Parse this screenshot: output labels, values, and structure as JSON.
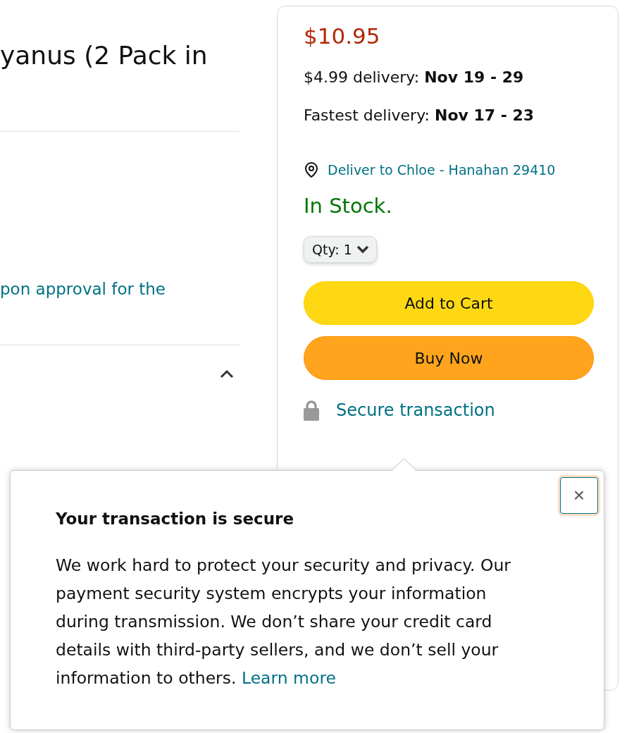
{
  "product": {
    "title": "yanus (2 Pack in",
    "note_link": "pon approval for the",
    "section_expanded": true
  },
  "buy_box": {
    "price": "$10.95",
    "delivery": [
      "$4.99 delivery: **Nov 19 - 29**",
      "Fastest delivery: **Nov 17 - 23**"
    ],
    "deliver_to": "Deliver to Chloe - Hanahan 29410",
    "stock": "In Stock.",
    "quantity": {
      "label": "Qty:",
      "value": "1"
    },
    "buttons": [
      {
        "label": "Add to Cart",
        "kind": "cart"
      },
      {
        "label": "Buy Now",
        "kind": "buy"
      }
    ],
    "secure": "Secure transaction"
  },
  "popover": {
    "title": "Your transaction is secure",
    "body": "We work hard to protect your security and privacy. Our payment security system encrypts your information during transmission. We don’t share your credit card details with third-party sellers, and we don’t sell your information to others.",
    "link": "Learn more",
    "close": "×"
  }
}
